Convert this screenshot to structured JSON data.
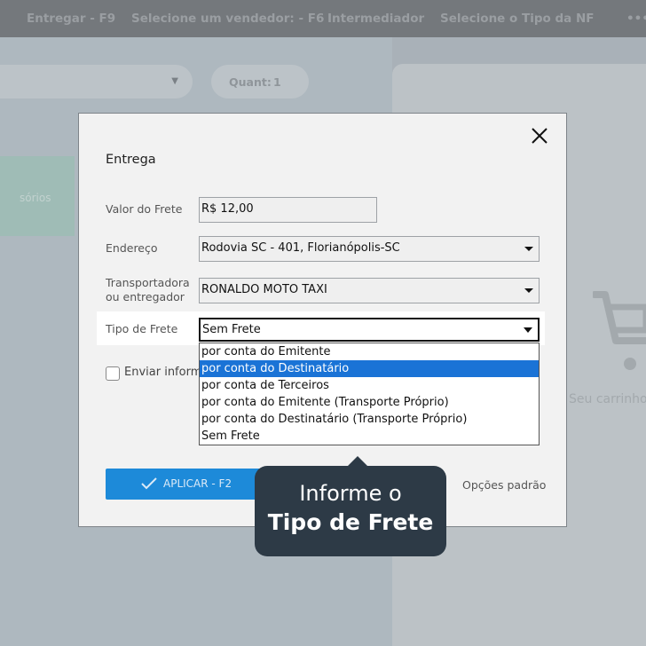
{
  "topbar": {
    "items": [
      "Entregar - F9",
      "Selecione um vendedor: - F6",
      "Intermediador",
      "Selecione o Tipo da NF",
      "•••"
    ]
  },
  "background": {
    "quant_label": "Quant:",
    "quant_value": "1",
    "tile_label": "sórios",
    "empty_cart_text": "Seu carrinho"
  },
  "modal": {
    "title": "Entrega",
    "frete": {
      "label": "Valor do Frete",
      "value": "R$ 12,00"
    },
    "endereco": {
      "label": "Endereço",
      "value": "Rodovia SC - 401, Florianópolis-SC"
    },
    "transportadora": {
      "label_line1": "Transportadora",
      "label_line2": "ou entregador",
      "value": "RONALDO MOTO TAXI"
    },
    "tipo_frete": {
      "label": "Tipo de Frete",
      "value": "Sem Frete",
      "options": [
        "por conta do Emitente",
        "por conta do Destinatário",
        "por conta de Terceiros",
        "por conta do Emitente (Transporte Próprio)",
        "por conta do Destinatário (Transporte Próprio)",
        "Sem Frete"
      ],
      "highlighted_index": 1
    },
    "enviar_label": "Enviar informações",
    "apply_label": "APLICAR - F2",
    "defaults_label": "Opções padrão"
  },
  "tooltip": {
    "line1": "Informe o",
    "line2": "Tipo de Frete"
  },
  "colors": {
    "accent": "#1d8ad9",
    "highlight": "#1a73d6",
    "tooltip_bg": "#2d3a46"
  }
}
